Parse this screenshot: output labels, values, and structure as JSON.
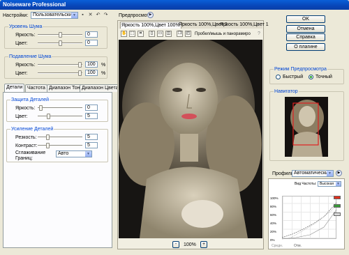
{
  "window": {
    "title": "Noiseware Professional"
  },
  "settings": {
    "label": "Настройки:",
    "preset": "Пользовательские"
  },
  "noise_level": {
    "title": "Уровень Шума",
    "rows": [
      {
        "label": "Яркость:",
        "value": "0"
      },
      {
        "label": "Цвет:",
        "value": "0"
      }
    ]
  },
  "noise_reduction": {
    "title": "Подавление Шума",
    "rows": [
      {
        "label": "Яркость:",
        "value": "100",
        "unit": "%"
      },
      {
        "label": "Цвет:",
        "value": "100",
        "unit": "%"
      }
    ]
  },
  "tabs": [
    "Детали",
    "Частота",
    "Диапазон Тона",
    "Диапазон Цвета"
  ],
  "detail_protection": {
    "title": "Защита Деталей",
    "rows": [
      {
        "label": "Яркость:",
        "value": "0"
      },
      {
        "label": "Цвет:",
        "value": "5"
      }
    ]
  },
  "detail_enhance": {
    "title": "Усиление Деталей",
    "rows": [
      {
        "label": "Резкость:",
        "value": "5"
      },
      {
        "label": "Контраст:",
        "value": "5"
      }
    ],
    "smoothing_label": "Сглаживание Границ:",
    "smoothing_value": "Авто"
  },
  "preview": {
    "label": "Предпросмотр",
    "tabs": [
      "Яркость 100%,Цвет 100%",
      "Яркость 100%,Цвет 2",
      "Яркость 100%,Цвет 1"
    ],
    "toolbar_text": "Пробел/мышь и панорамиро",
    "zoom_minus": "-",
    "zoom_value": "100%",
    "zoom_plus": "+"
  },
  "buttons": {
    "ok": "OK",
    "cancel": "Отмена",
    "help": "Справка",
    "about": "О плагине"
  },
  "preview_mode": {
    "title": "Режим Предпросмотра",
    "fast": "Быстрый",
    "accurate": "Точный",
    "selected": "accurate"
  },
  "navigator": {
    "title": "Навигатор"
  },
  "profile": {
    "label": "Профиль:",
    "value": "Автоматический",
    "freq_label": "Вид Частоты:",
    "freq_value": "Высокая",
    "percent_ticks": [
      "100%",
      "80%",
      "60%",
      "40%",
      "20%",
      "0%"
    ],
    "bottom_left": "Средн.",
    "bottom_mid": "Отм."
  }
}
